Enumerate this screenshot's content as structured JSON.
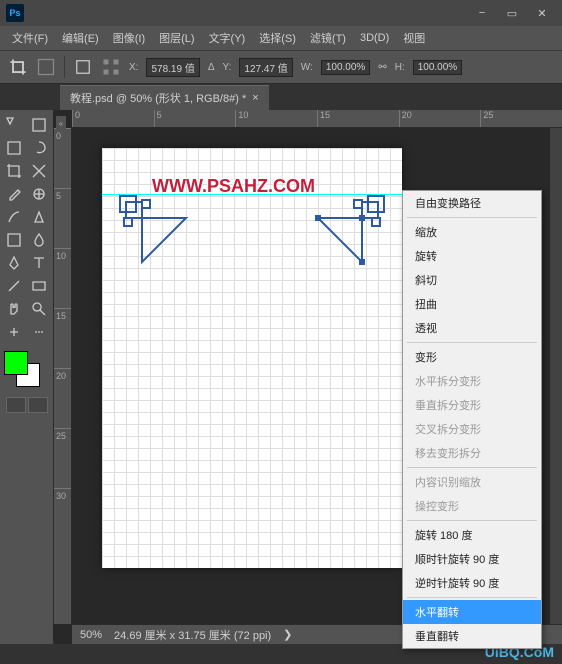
{
  "app": {
    "logo": "Ps"
  },
  "menubar": [
    "文件(F)",
    "编辑(E)",
    "图像(I)",
    "图层(L)",
    "文字(Y)",
    "选择(S)",
    "滤镜(T)",
    "3D(D)",
    "视图"
  ],
  "window_buttons": {
    "min": "−",
    "restore": "▭",
    "close": "✕"
  },
  "options": {
    "x_label": "X:",
    "x_val": "578.19 值",
    "y_label": "Y:",
    "y_val": "127.47 值",
    "w_label": "W:",
    "w_val": "100.00%",
    "h_label": "H:",
    "h_val": "100.00%"
  },
  "tab": {
    "title": "教程.psd @ 50% (形状 1, RGB/8#) *",
    "close": "×"
  },
  "ruler_h": [
    "0",
    "5",
    "10",
    "15",
    "20",
    "25"
  ],
  "ruler_v": [
    "0",
    "5",
    "10",
    "15",
    "20",
    "25",
    "30"
  ],
  "watermark": "WWW.PSAHZ.COM",
  "status": {
    "zoom": "50%",
    "dims": "24.69 厘米 x 31.75 厘米 (72 ppi)",
    "chev": "❯"
  },
  "context_menu": [
    {
      "label": "自由变换路径",
      "type": "item"
    },
    {
      "type": "sep"
    },
    {
      "label": "缩放",
      "type": "item"
    },
    {
      "label": "旋转",
      "type": "item"
    },
    {
      "label": "斜切",
      "type": "item"
    },
    {
      "label": "扭曲",
      "type": "item"
    },
    {
      "label": "透视",
      "type": "item"
    },
    {
      "type": "sep"
    },
    {
      "label": "变形",
      "type": "item"
    },
    {
      "label": "水平拆分变形",
      "type": "disabled"
    },
    {
      "label": "垂直拆分变形",
      "type": "disabled"
    },
    {
      "label": "交叉拆分变形",
      "type": "disabled"
    },
    {
      "label": "移去变形拆分",
      "type": "disabled"
    },
    {
      "type": "sep"
    },
    {
      "label": "内容识别缩放",
      "type": "disabled"
    },
    {
      "label": "操控变形",
      "type": "disabled"
    },
    {
      "type": "sep"
    },
    {
      "label": "旋转 180 度",
      "type": "item"
    },
    {
      "label": "顺时针旋转 90 度",
      "type": "item"
    },
    {
      "label": "逆时针旋转 90 度",
      "type": "item"
    },
    {
      "type": "sep"
    },
    {
      "label": "水平翻转",
      "type": "highlight"
    },
    {
      "label": "垂直翻转",
      "type": "item"
    }
  ],
  "brand": "UiBQ.CoM",
  "collapse": "«"
}
